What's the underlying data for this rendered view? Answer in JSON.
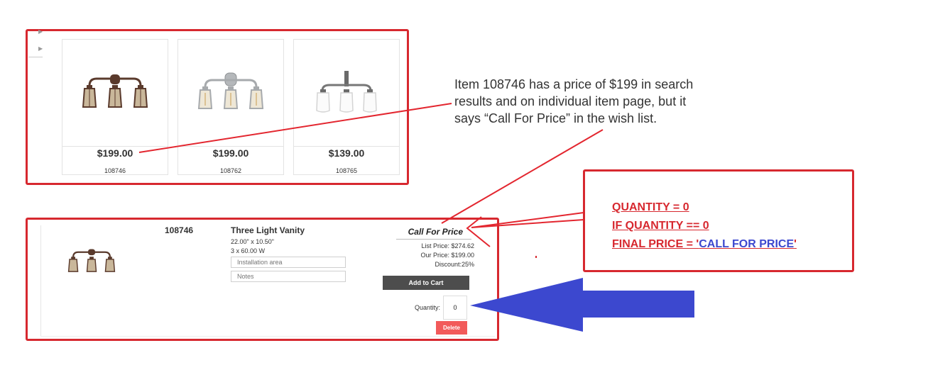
{
  "search_results": {
    "items": [
      {
        "price": "$199.00",
        "sku": "108746"
      },
      {
        "price": "$199.00",
        "sku": "108762"
      },
      {
        "price": "$139.00",
        "sku": "108765"
      }
    ]
  },
  "annotation": {
    "text": "Item 108746 has a price of $199 in search results and on individual item page, but it says “Call For Price” in the wish list."
  },
  "logic_note": {
    "line1": "QUANTITY = 0",
    "line2": "IF QUANTITY == 0",
    "line3_prefix": "FINAL PRICE = '",
    "line3_value": "CALL FOR PRICE",
    "line3_suffix": "'"
  },
  "wishlist": {
    "sku": "108746",
    "name": "Three Light Vanity",
    "dimensions": "22.00\" x 10.50\"",
    "wattage": "3 x 60.00 W",
    "installation_placeholder": "Installation area",
    "notes_placeholder": "Notes",
    "call_for_price": "Call For Price",
    "list_price": "List Price: $274.62",
    "our_price": "Our Price: $199.00",
    "discount": "Discount:25%",
    "add_to_cart": "Add to Cart",
    "quantity_label": "Quantity:",
    "quantity_value": "0",
    "delete_label": "Delete"
  },
  "colors": {
    "annotation_red": "#d7282f",
    "arrow_blue": "#3c48cf",
    "add_to_cart_bg": "#4d4d4d",
    "delete_bg": "#f25a5a"
  }
}
